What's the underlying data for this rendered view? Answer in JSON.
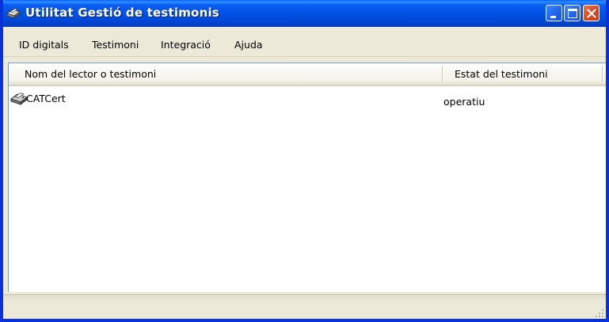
{
  "window": {
    "title": "Utilitat Gestió de testimonis"
  },
  "menubar": {
    "items": [
      "ID digitals",
      "Testimoni",
      "Integració",
      "Ajuda"
    ]
  },
  "list": {
    "columns": [
      "Nom del lector o testimoni",
      "Estat del testimoni"
    ],
    "rows": [
      {
        "name": "CATCert",
        "status": "operatiu",
        "icon": "card-reader-icon"
      }
    ]
  },
  "colors": {
    "titlebar": "#0052e5",
    "close_button": "#d6461f",
    "window_face": "#ece9d8"
  }
}
